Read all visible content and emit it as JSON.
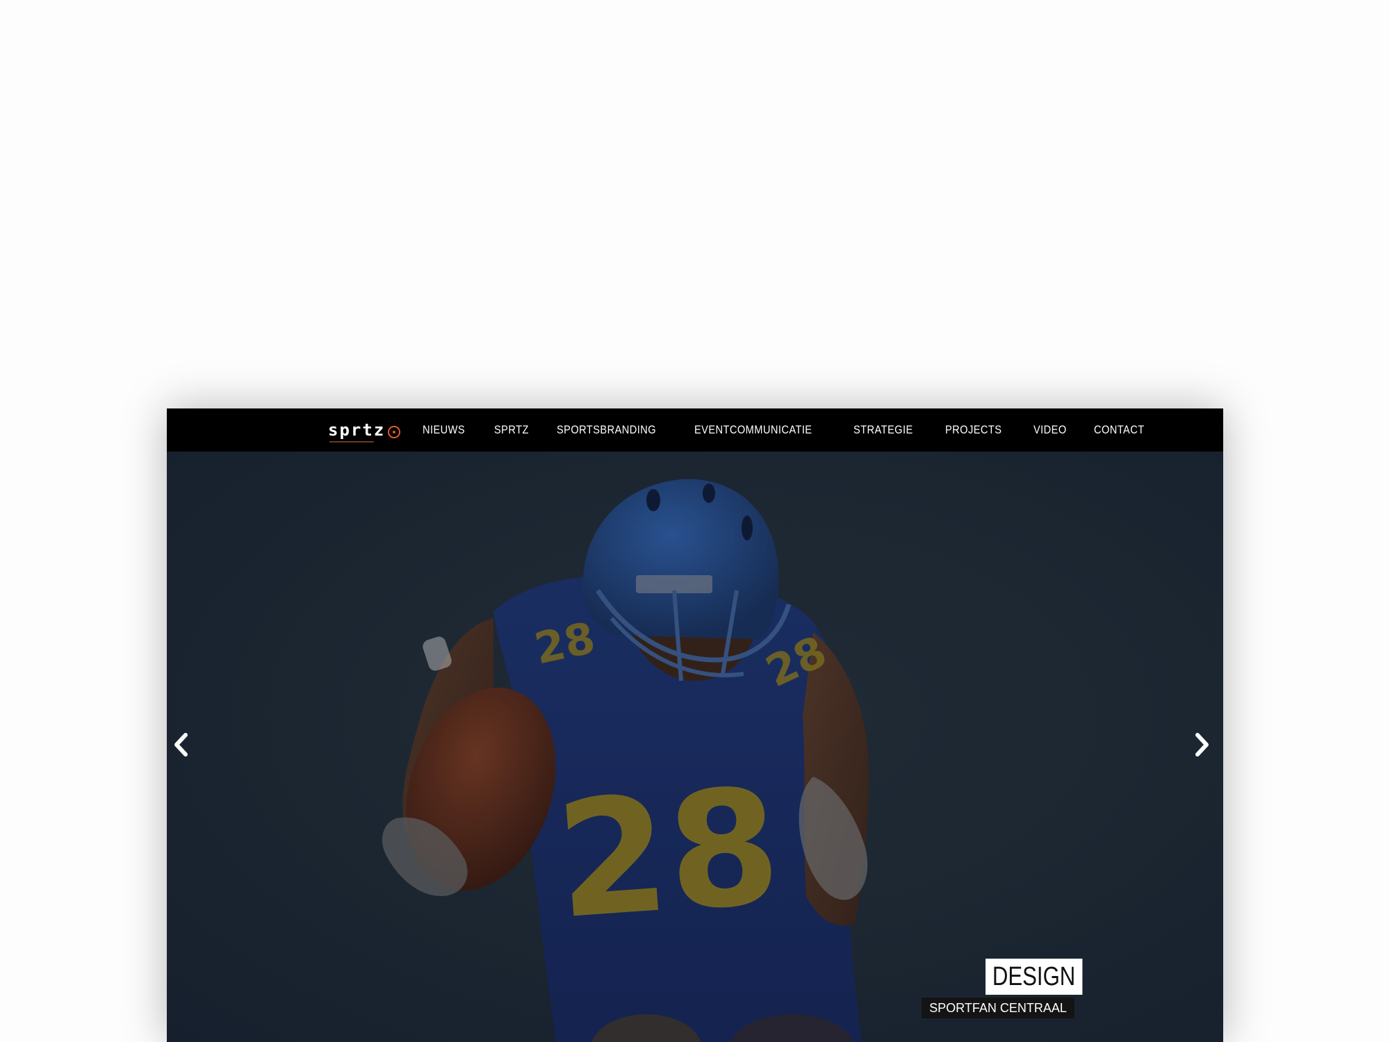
{
  "brand": {
    "logo_text": "sprtz",
    "accent_color": "#e05a2b"
  },
  "nav": {
    "items": [
      {
        "label": "NIEUWS"
      },
      {
        "label": "SPRTZ"
      },
      {
        "label": "SPORTSBRANDING"
      },
      {
        "label": "EVENTCOMMUNICATIE"
      },
      {
        "label": "STRATEGIE"
      },
      {
        "label": "PROJECTS"
      },
      {
        "label": "VIDEO"
      },
      {
        "label": "CONTACT"
      }
    ]
  },
  "slider": {
    "caption_title": "DESIGN",
    "caption_subtitle": "SPORTFAN CENTRAAL",
    "prev_icon": "chevron-left-icon",
    "next_icon": "chevron-right-icon",
    "jersey_number": "28"
  }
}
